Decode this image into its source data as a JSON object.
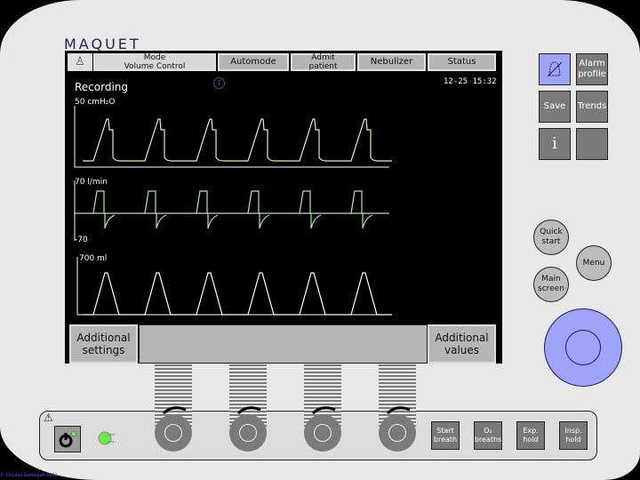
{
  "brand": "MAQUET",
  "top_bar": {
    "mode_line1": "Mode",
    "mode_line2": "Volume Control",
    "automode": "Automode",
    "admit_line1": "Admit",
    "admit_line2": "patient",
    "nebulizer": "Nebulizer",
    "status": "Status"
  },
  "screen": {
    "recording": "Recording",
    "clock": "12-25 15:32",
    "info_marker": "T"
  },
  "waveforms": {
    "pressure": {
      "label": "50 cmH₂O",
      "max": 50,
      "unit": "cmH2O",
      "breaths": 6
    },
    "flow": {
      "label": "70  l/min",
      "min_label": "-70",
      "max": 70,
      "min": -70,
      "unit": "l/min",
      "breaths": 6
    },
    "volume": {
      "label": "700 ml",
      "max": 700,
      "unit": "ml",
      "breaths": 6
    }
  },
  "side_buttons": {
    "alarm_profile_line1": "Alarm",
    "alarm_profile_line2": "profile",
    "save": "Save",
    "trends": "Trends",
    "info": "i"
  },
  "round_buttons": {
    "quick_start_line1": "Quick",
    "quick_start_line2": "start",
    "menu": "Menu",
    "main_screen_line1": "Main",
    "main_screen_line2": "screen"
  },
  "bottom_screen": {
    "additional_settings_line1": "Additional",
    "additional_settings_line2": "settings",
    "additional_values_line1": "Additional",
    "additional_values_line2": "values"
  },
  "panel_buttons": {
    "start_breath_line1": "Start",
    "start_breath_line2": "breath",
    "o2_breaths_line1": "O₂",
    "o2_breaths_line2": "breaths",
    "exp_hold_line1": "Exp.",
    "exp_hold_line2": "hold",
    "insp_hold_line1": "Insp.",
    "insp_hold_line2": "hold"
  },
  "colors": {
    "pressure_wave": "#f0f0b0",
    "flow_wave": "#a8f0a0",
    "volume_wave": "#ffffff",
    "alarm_button": "#9ea4f8",
    "dial": "#9ea4f8",
    "power_led": "#66ee44"
  },
  "copyright": "© Chudas Gemusall 2002"
}
